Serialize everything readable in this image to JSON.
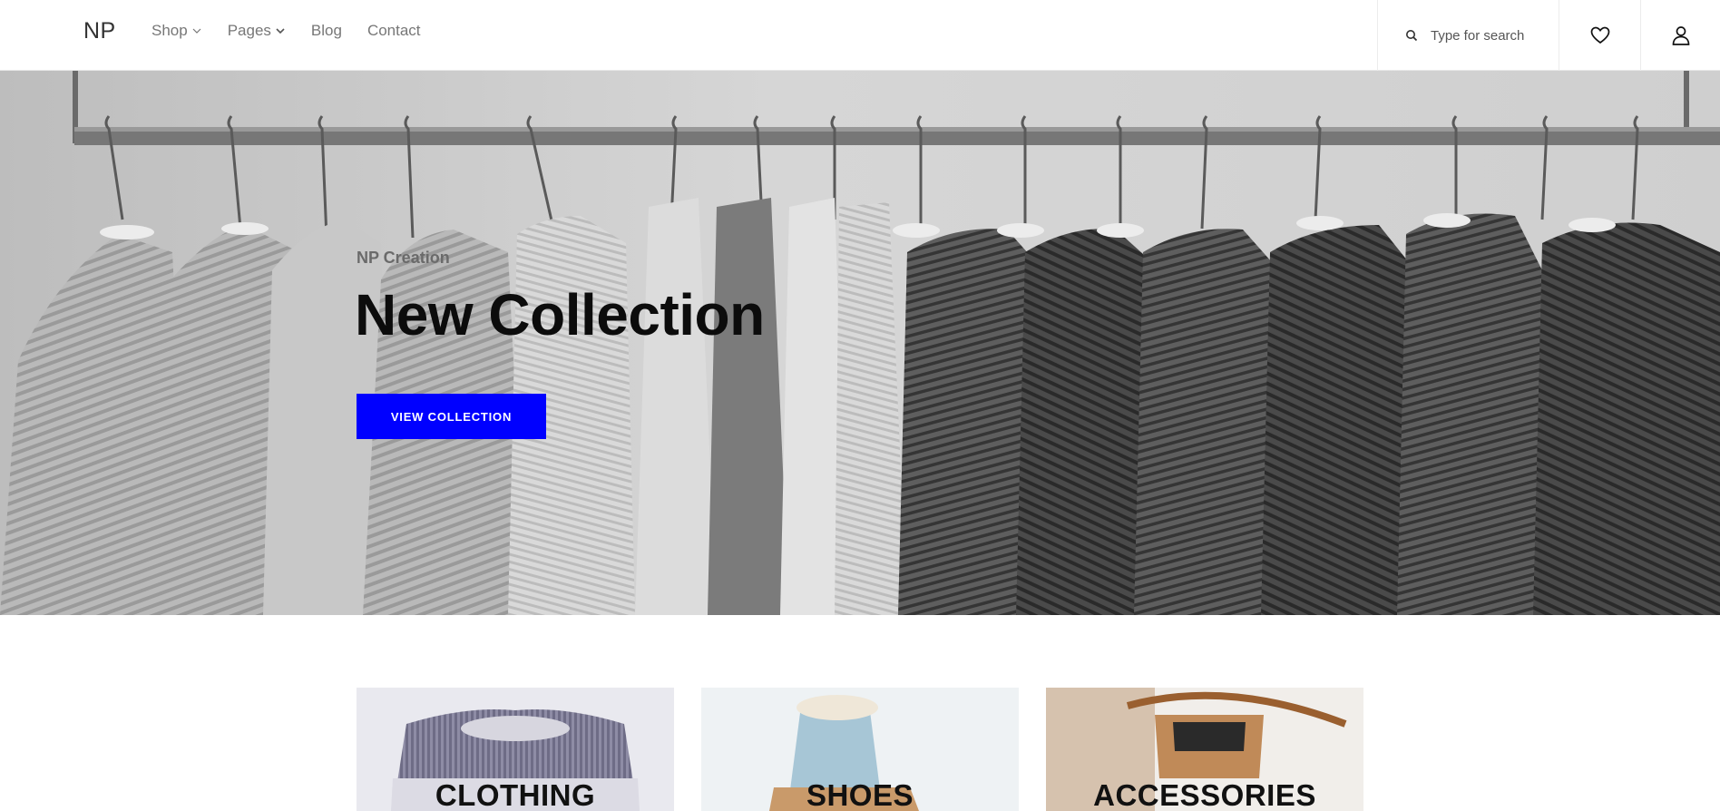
{
  "header": {
    "logo": "NP",
    "nav": [
      {
        "label": "Shop",
        "has_dropdown": true
      },
      {
        "label": "Pages",
        "has_dropdown": true
      },
      {
        "label": "Blog",
        "has_dropdown": false
      },
      {
        "label": "Contact",
        "has_dropdown": false
      }
    ],
    "search": {
      "placeholder": "Type for search",
      "icon": "search-icon"
    },
    "wishlist_icon": "heart-icon",
    "account_icon": "user-icon"
  },
  "hero": {
    "subtitle": "NP Creation",
    "title": "New Collection",
    "button_label": "VIEW COLLECTION",
    "button_color": "#0000ff"
  },
  "categories": [
    {
      "label": "CLOTHING"
    },
    {
      "label": "SHOES"
    },
    {
      "label": "ACCESSORIES"
    }
  ]
}
